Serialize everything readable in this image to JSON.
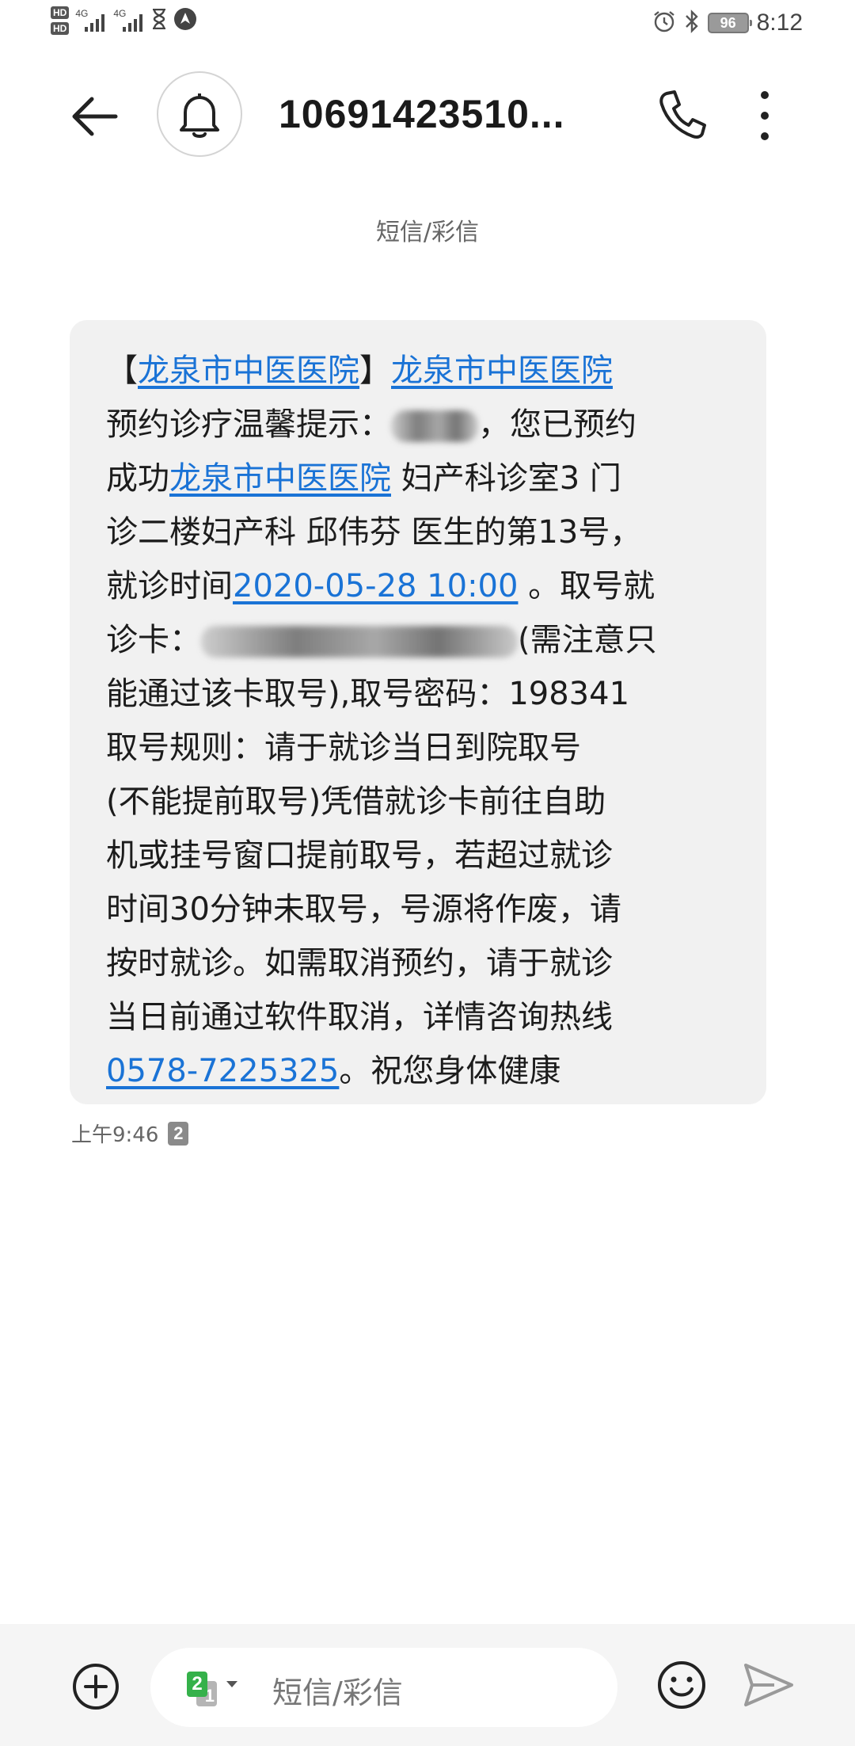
{
  "status_bar": {
    "left_badges": [
      "HD",
      "HD"
    ],
    "network_labels": [
      "4G",
      "4G"
    ],
    "battery_level": "96",
    "time": "8:12",
    "icons": [
      "hd-icon",
      "signal-icon",
      "hourglass-icon",
      "navigation-icon",
      "alarm-icon",
      "bluetooth-icon",
      "battery-icon"
    ]
  },
  "header": {
    "contact": "10691423510...",
    "icons": [
      "back-arrow-icon",
      "bell-icon",
      "phone-icon",
      "more-vertical-icon"
    ]
  },
  "thread": {
    "channel_label": "短信/彩信",
    "message": {
      "line1_open": "【",
      "line1_sender": "龙泉市中医医院",
      "line1_close": "】",
      "line1_link": "龙泉市中医医院",
      "line2_start": "预约诊疗温馨提示：",
      "line2_end": "，您已预约",
      "line3_start": "成功",
      "line3_link": "龙泉市中医医院",
      "line3_end": " 妇产科诊室3 门",
      "line4": "诊二楼妇产科 邱伟芬 医生的第13号，",
      "line5_start": "就诊时间",
      "line5_link": "2020-05-28  10:00",
      "line5_end": " 。取号就",
      "line6_start": "诊卡：",
      "line6_end": "(需注意只",
      "line7": "能通过该卡取号),取号密码：198341",
      "line8": "取号规则：请于就诊当日到院取号",
      "line9": "(不能提前取号)凭借就诊卡前往自助",
      "line10": "机或挂号窗口提前取号，若超过就诊",
      "line11": "时间30分钟未取号，号源将作废，请",
      "line12": "按时就诊。如需取消预约，请于就诊",
      "line13": "当日前通过软件取消，详情咨询热线",
      "line14_link": "0578-7225325",
      "line14_end": "。祝您身体健康",
      "time": "上午9:46",
      "sim": "2"
    }
  },
  "compose": {
    "placeholder": "短信/彩信",
    "sim_front": "2",
    "sim_back": "1",
    "icons": [
      "add-icon",
      "sim-card-icon",
      "emoji-icon",
      "send-icon"
    ]
  },
  "colors": {
    "link": "#1a73d6",
    "bubble": "#f1f1f1",
    "sim_green": "#35b14a",
    "compose_bar": "#f5f5f5"
  }
}
